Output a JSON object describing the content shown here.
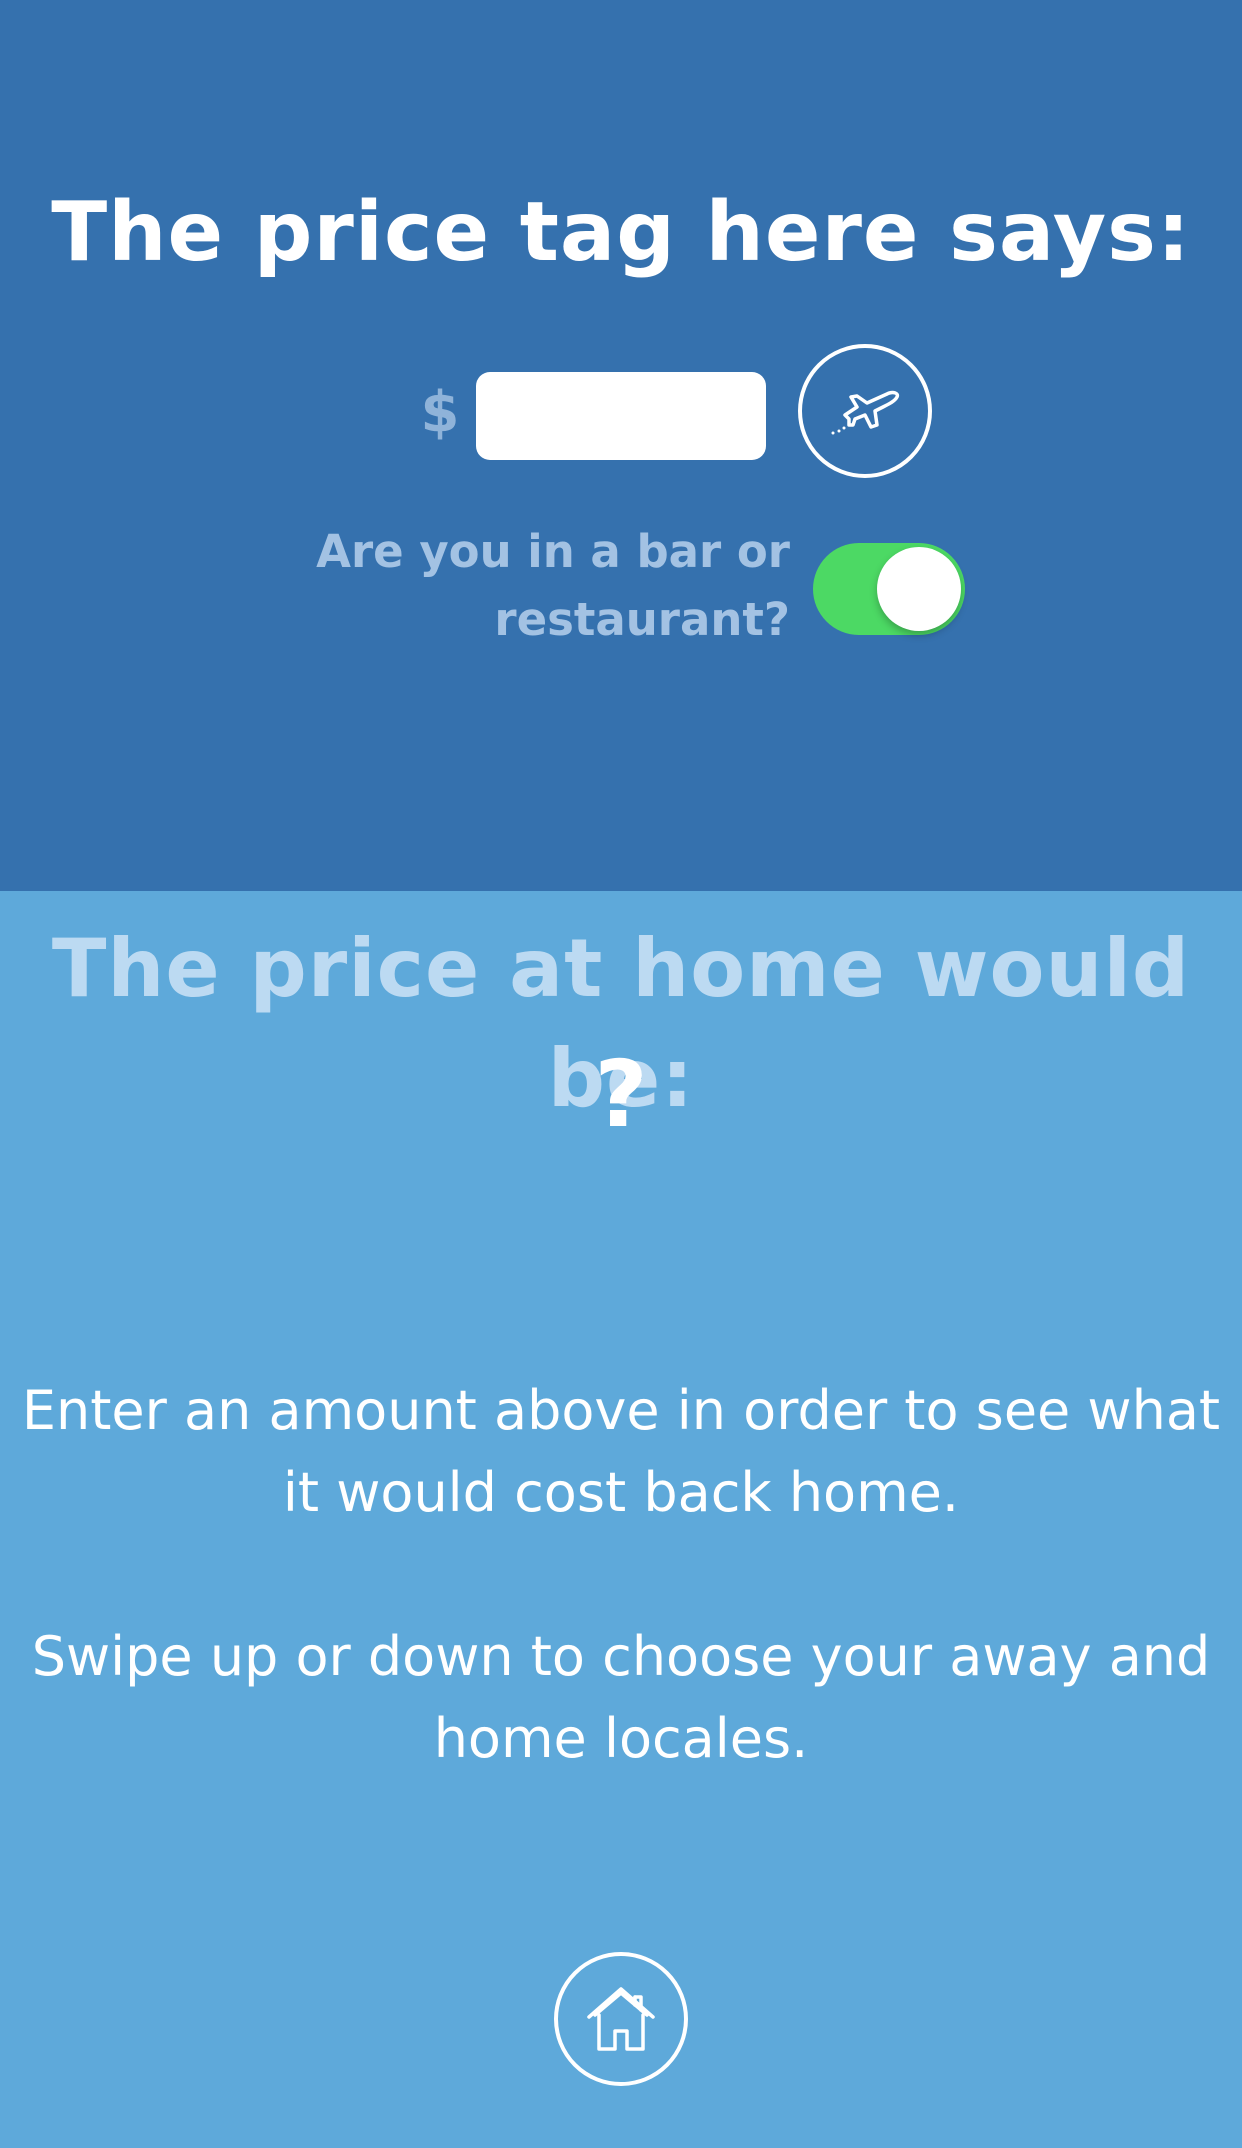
{
  "away": {
    "title": "The price tag here says:",
    "currency_symbol": "$",
    "price_value": "",
    "locale_icon": "airplane-icon",
    "toggle_label_line1": "Are you in a bar or",
    "toggle_label_line2": "restaurant?",
    "toggle_on": true,
    "background_color": "#3571ae"
  },
  "home": {
    "title": "The price at home would be:",
    "price": "?",
    "instruction_1": "Enter an amount above in order to see what it would cost back home.",
    "instruction_2": "Swipe up or down to choose your away and home locales.",
    "locale_icon": "house-icon",
    "background_color": "#5ea9da"
  },
  "colors": {
    "toggle_on": "#4cd964"
  }
}
